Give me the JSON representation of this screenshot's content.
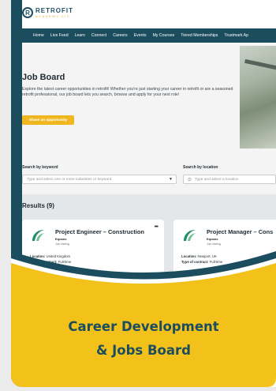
{
  "logo": {
    "brand": "RETROFIT",
    "sub": "ACADEMY CIC"
  },
  "nav": [
    "Home",
    "Live Feed",
    "Learn",
    "Connect",
    "Careers",
    "Events",
    "My Courses",
    "Tiered Memberships",
    "Trustmark Ap"
  ],
  "page": {
    "title": "Job Board",
    "description": "Explore the latest career opportunities in retrofit! Whether you're just starting your career in retrofit or are a seasoned retrofit professional, our job board lets you search, browse and apply for your next role!",
    "share_button": "Share an opportunity"
  },
  "search": {
    "keyword_label": "Search by keyword",
    "keyword_placeholder": "Type and select one or more industries or keyword",
    "location_label": "Search by location",
    "location_placeholder": "Type and select a location"
  },
  "results": {
    "title": "Results (9)",
    "jobs": [
      {
        "title": "Project Engineer – Construction",
        "company": "Equans",
        "type": "Job listing",
        "location_label": "Location:",
        "location": "United Kingdom",
        "contract_label": "Type of contract:",
        "contract": "Full-time"
      },
      {
        "title": "Project Manager – Cons",
        "company": "Equans",
        "type": "Job listing",
        "location_label": "Location:",
        "location": "Newport, UK",
        "contract_label": "Type of contract:",
        "contract": "Full-time"
      }
    ]
  },
  "banner": {
    "line1": "Career Development",
    "line2": "& Jobs Board"
  },
  "colors": {
    "teal": "#1b4d5f",
    "gold": "#f0b61f",
    "banner_yellow": "#f2c21a"
  }
}
